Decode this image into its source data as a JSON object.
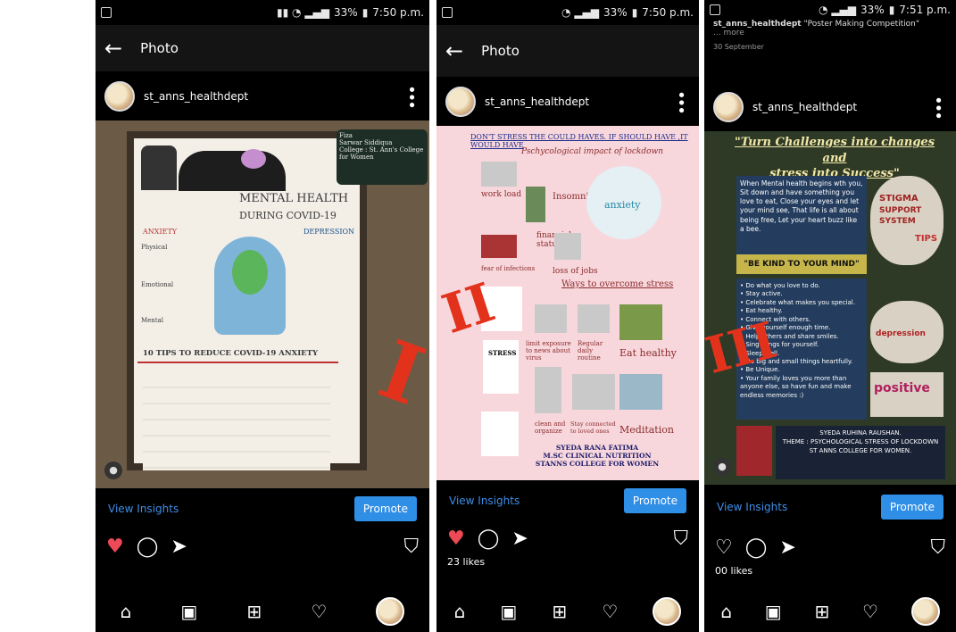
{
  "status": {
    "p1": {
      "battery": "33%",
      "time": "7:50 p.m."
    },
    "p2": {
      "battery": "33%",
      "time": "7:50 p.m."
    },
    "p3": {
      "battery": "33%",
      "time": "7:51 p.m."
    }
  },
  "appbar": {
    "back": "←",
    "title": "Photo"
  },
  "username": "st_anns_healthdept",
  "caption": {
    "user": "st_anns_healthdept",
    "text": "\"Poster Making Competition\"",
    "more": "... more",
    "date": "30 September"
  },
  "insights": {
    "link": "View Insights",
    "promote": "Promote"
  },
  "likes": {
    "p2": "23 likes",
    "p3": "00 likes"
  },
  "marks": {
    "p1": "I",
    "p2": "II",
    "p3": "III"
  },
  "poster1": {
    "credit1": "Fiza",
    "credit2": "Sarwar Siddiqua",
    "credit3": "College : St. Ann's College",
    "credit4": "for Women",
    "title1": "MENTAL HEALTH",
    "title2": "DURING COVID-19",
    "anxiety": "ANXIETY",
    "depression": "DEPRESSION",
    "physical": "Physical",
    "emotional": "Emotional",
    "mental": "Mental",
    "tips": "10 TIPS TO REDUCE COVID-19 ANXIETY"
  },
  "poster2": {
    "headline": "DON'T STRESS THE COULD HAVES. IF SHOULD HAVE ,IT WOULD HAVE",
    "subhead": "Pschycological impact of lockdown",
    "work": "work load",
    "insomnia": "Insomnia",
    "anxiety": "anxiety",
    "financial": "financial status",
    "infections": "fear of infections",
    "jobs": "loss of jobs",
    "overcome": "Ways to overcome stress",
    "stress": "STRESS",
    "limit": "limit exposure to news about virus",
    "routine": "Regular daily routine",
    "eat": "Eat healthy",
    "clean": "clean and organize",
    "loved": "Stay connected to loved ones",
    "meditation": "Meditation",
    "author1": "SYEDA RANA FATIMA",
    "author2": "M.SC CLINICAL NUTRITION",
    "author3": "STANNS COLLEGE FOR WOMEN"
  },
  "poster3": {
    "title1": "\"Turn Challenges into changes and",
    "title2": "stress into Success\"",
    "para": "When Mental health begins wth you, Sit down and have something you love to eat, Close your eyes and let your mind see, That life is all about being free, Let your heart buzz like a bee.",
    "kind": "\"BE KIND TO YOUR MIND\"",
    "tips": [
      "Do what you love to do.",
      "Stay active.",
      "Celebrate what makes you special.",
      "Eat healthy.",
      "Connect with others.",
      "Give yourself enough time.",
      "Help others and share smiles.",
      "Sing songs for yourself.",
      "Sleep well.",
      "Do big and small things heartfully.",
      "Be Unique.",
      "Your family loves you more than anyone else, so have fun and make endless memories :)"
    ],
    "credit1": "SYEDA RUHINA RAUSHAN.",
    "credit2": "THEME : PSYCHOLOGICAL STRESS OF LOCKDOWN",
    "credit3": "ST ANNS COLLEGE FOR WOMEN.",
    "words": [
      "STIGMA",
      "SUPPORT",
      "SYSTEM",
      "TIPS",
      "depression",
      "positive"
    ]
  }
}
